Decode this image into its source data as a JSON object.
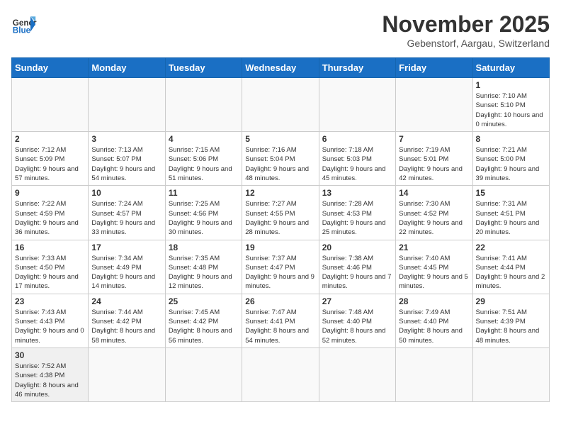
{
  "logo": {
    "text_general": "General",
    "text_blue": "Blue"
  },
  "header": {
    "month": "November 2025",
    "location": "Gebenstorf, Aargau, Switzerland"
  },
  "days_of_week": [
    "Sunday",
    "Monday",
    "Tuesday",
    "Wednesday",
    "Thursday",
    "Friday",
    "Saturday"
  ],
  "weeks": [
    [
      {
        "day": "",
        "info": ""
      },
      {
        "day": "",
        "info": ""
      },
      {
        "day": "",
        "info": ""
      },
      {
        "day": "",
        "info": ""
      },
      {
        "day": "",
        "info": ""
      },
      {
        "day": "",
        "info": ""
      },
      {
        "day": "1",
        "info": "Sunrise: 7:10 AM\nSunset: 5:10 PM\nDaylight: 10 hours and 0 minutes."
      }
    ],
    [
      {
        "day": "2",
        "info": "Sunrise: 7:12 AM\nSunset: 5:09 PM\nDaylight: 9 hours and 57 minutes."
      },
      {
        "day": "3",
        "info": "Sunrise: 7:13 AM\nSunset: 5:07 PM\nDaylight: 9 hours and 54 minutes."
      },
      {
        "day": "4",
        "info": "Sunrise: 7:15 AM\nSunset: 5:06 PM\nDaylight: 9 hours and 51 minutes."
      },
      {
        "day": "5",
        "info": "Sunrise: 7:16 AM\nSunset: 5:04 PM\nDaylight: 9 hours and 48 minutes."
      },
      {
        "day": "6",
        "info": "Sunrise: 7:18 AM\nSunset: 5:03 PM\nDaylight: 9 hours and 45 minutes."
      },
      {
        "day": "7",
        "info": "Sunrise: 7:19 AM\nSunset: 5:01 PM\nDaylight: 9 hours and 42 minutes."
      },
      {
        "day": "8",
        "info": "Sunrise: 7:21 AM\nSunset: 5:00 PM\nDaylight: 9 hours and 39 minutes."
      }
    ],
    [
      {
        "day": "9",
        "info": "Sunrise: 7:22 AM\nSunset: 4:59 PM\nDaylight: 9 hours and 36 minutes."
      },
      {
        "day": "10",
        "info": "Sunrise: 7:24 AM\nSunset: 4:57 PM\nDaylight: 9 hours and 33 minutes."
      },
      {
        "day": "11",
        "info": "Sunrise: 7:25 AM\nSunset: 4:56 PM\nDaylight: 9 hours and 30 minutes."
      },
      {
        "day": "12",
        "info": "Sunrise: 7:27 AM\nSunset: 4:55 PM\nDaylight: 9 hours and 28 minutes."
      },
      {
        "day": "13",
        "info": "Sunrise: 7:28 AM\nSunset: 4:53 PM\nDaylight: 9 hours and 25 minutes."
      },
      {
        "day": "14",
        "info": "Sunrise: 7:30 AM\nSunset: 4:52 PM\nDaylight: 9 hours and 22 minutes."
      },
      {
        "day": "15",
        "info": "Sunrise: 7:31 AM\nSunset: 4:51 PM\nDaylight: 9 hours and 20 minutes."
      }
    ],
    [
      {
        "day": "16",
        "info": "Sunrise: 7:33 AM\nSunset: 4:50 PM\nDaylight: 9 hours and 17 minutes."
      },
      {
        "day": "17",
        "info": "Sunrise: 7:34 AM\nSunset: 4:49 PM\nDaylight: 9 hours and 14 minutes."
      },
      {
        "day": "18",
        "info": "Sunrise: 7:35 AM\nSunset: 4:48 PM\nDaylight: 9 hours and 12 minutes."
      },
      {
        "day": "19",
        "info": "Sunrise: 7:37 AM\nSunset: 4:47 PM\nDaylight: 9 hours and 9 minutes."
      },
      {
        "day": "20",
        "info": "Sunrise: 7:38 AM\nSunset: 4:46 PM\nDaylight: 9 hours and 7 minutes."
      },
      {
        "day": "21",
        "info": "Sunrise: 7:40 AM\nSunset: 4:45 PM\nDaylight: 9 hours and 5 minutes."
      },
      {
        "day": "22",
        "info": "Sunrise: 7:41 AM\nSunset: 4:44 PM\nDaylight: 9 hours and 2 minutes."
      }
    ],
    [
      {
        "day": "23",
        "info": "Sunrise: 7:43 AM\nSunset: 4:43 PM\nDaylight: 9 hours and 0 minutes."
      },
      {
        "day": "24",
        "info": "Sunrise: 7:44 AM\nSunset: 4:42 PM\nDaylight: 8 hours and 58 minutes."
      },
      {
        "day": "25",
        "info": "Sunrise: 7:45 AM\nSunset: 4:42 PM\nDaylight: 8 hours and 56 minutes."
      },
      {
        "day": "26",
        "info": "Sunrise: 7:47 AM\nSunset: 4:41 PM\nDaylight: 8 hours and 54 minutes."
      },
      {
        "day": "27",
        "info": "Sunrise: 7:48 AM\nSunset: 4:40 PM\nDaylight: 8 hours and 52 minutes."
      },
      {
        "day": "28",
        "info": "Sunrise: 7:49 AM\nSunset: 4:40 PM\nDaylight: 8 hours and 50 minutes."
      },
      {
        "day": "29",
        "info": "Sunrise: 7:51 AM\nSunset: 4:39 PM\nDaylight: 8 hours and 48 minutes."
      }
    ],
    [
      {
        "day": "30",
        "info": "Sunrise: 7:52 AM\nSunset: 4:38 PM\nDaylight: 8 hours and 46 minutes."
      },
      {
        "day": "",
        "info": ""
      },
      {
        "day": "",
        "info": ""
      },
      {
        "day": "",
        "info": ""
      },
      {
        "day": "",
        "info": ""
      },
      {
        "day": "",
        "info": ""
      },
      {
        "day": "",
        "info": ""
      }
    ]
  ]
}
